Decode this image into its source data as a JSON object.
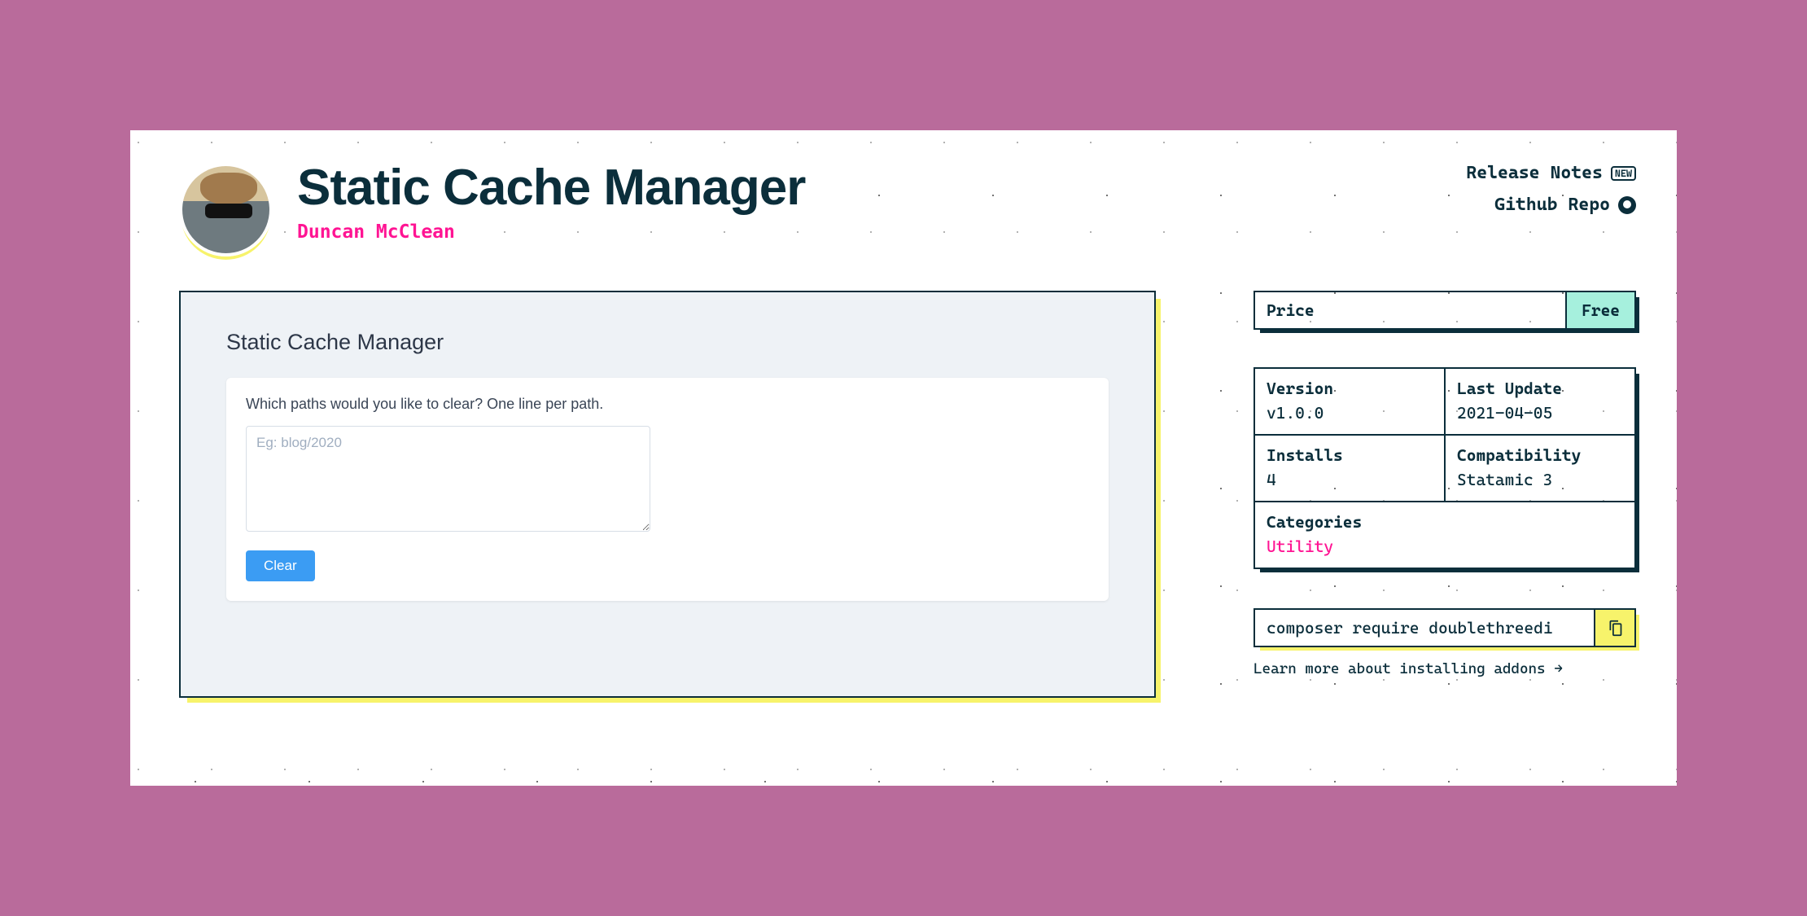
{
  "header": {
    "title": "Static Cache Manager",
    "author": "Duncan McClean",
    "links": {
      "release_notes": "Release Notes",
      "new_badge": "NEW",
      "github_repo": "Github Repo"
    }
  },
  "screenshot": {
    "title": "Static Cache Manager",
    "prompt": "Which paths would you like to clear? One line per path.",
    "placeholder": "Eg: blog/2020",
    "clear_button": "Clear"
  },
  "price": {
    "label": "Price",
    "value": "Free"
  },
  "meta": {
    "version_label": "Version",
    "version": "v1.0.0",
    "last_update_label": "Last Update",
    "last_update": "2021-04-05",
    "installs_label": "Installs",
    "installs": "4",
    "compat_label": "Compatibility",
    "compat": "Statamic 3",
    "categories_label": "Categories",
    "category": "Utility"
  },
  "install": {
    "command": "composer require doublethreedi",
    "learn_prefix": "Learn more about ",
    "learn_link": "installing addons",
    "arrow": " →"
  }
}
